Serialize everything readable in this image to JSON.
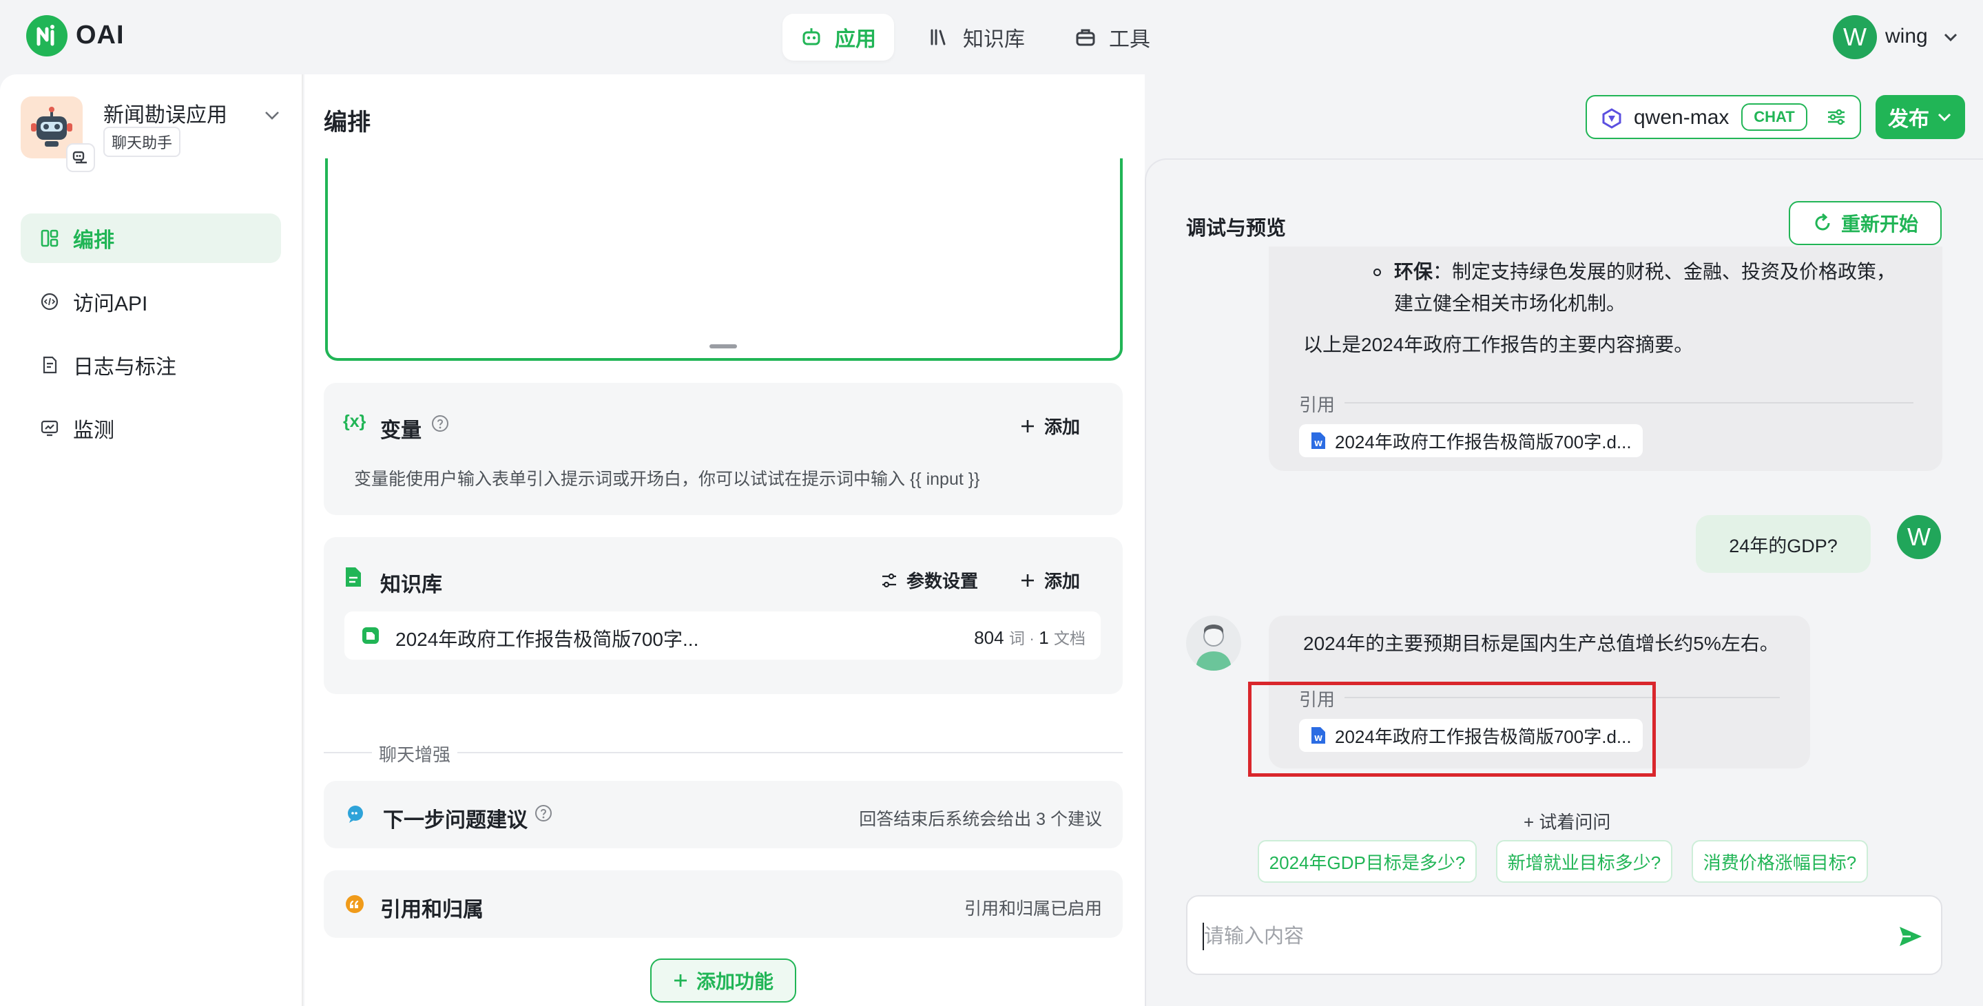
{
  "brand": {
    "name": "OAI"
  },
  "topnav": [
    {
      "label": "应用",
      "icon": "robot-icon",
      "active": true
    },
    {
      "label": "知识库",
      "icon": "books-icon",
      "active": false
    },
    {
      "label": "工具",
      "icon": "toolbox-icon",
      "active": false
    }
  ],
  "user": {
    "initial": "W",
    "name": "wing"
  },
  "app": {
    "name": "新闻勘误应用",
    "type": "聊天助手"
  },
  "sidebar": {
    "items": [
      {
        "label": "编排",
        "icon": "layout-icon",
        "active": true
      },
      {
        "label": "访问API",
        "icon": "api-icon",
        "active": false
      },
      {
        "label": "日志与标注",
        "icon": "log-icon",
        "active": false
      },
      {
        "label": "监测",
        "icon": "monitor-icon",
        "active": false
      }
    ]
  },
  "center": {
    "title": "编排",
    "variables": {
      "icon_text": "{x}",
      "title": "变量",
      "add_label": "添加",
      "desc": "变量能使用户输入表单引入提示词或开场白，你可以试试在提示词中输入 {{ input }}"
    },
    "knowledge": {
      "title": "知识库",
      "param_label": "参数设置",
      "add_label": "添加",
      "file_name": "2024年政府工作报告极简版700字...",
      "word_count": "804",
      "word_unit": "词 · ",
      "doc_count": "1",
      "doc_unit": "文档"
    },
    "section_label": "聊天增强",
    "next_question": {
      "title": "下一步问题建议",
      "desc": "回答结束后系统会给出 3 个建议"
    },
    "citation": {
      "title": "引用和归属",
      "desc": "引用和归属已启用"
    },
    "add_feature_label": "添加功能"
  },
  "model": {
    "name": "qwen-max",
    "tag": "CHAT"
  },
  "publish_label": "发布",
  "preview": {
    "title": "调试与预览",
    "restart_label": "重新开始",
    "msg1": {
      "bullet_bold": "环保",
      "bullet_rest": "：制定支持绿色发展的财税、金融、投资及价格政策，",
      "bullet_line2": "建立健全相关市场化机制。",
      "summary": "以上是2024年政府工作报告的主要内容摘要。",
      "cite_label": "引用",
      "cite_file": "2024年政府工作报告极简版700字.d..."
    },
    "user_msg": "24年的GDP?",
    "user_initial": "W",
    "msg2": {
      "text": "2024年的主要预期目标是国内生产总值增长约5%左右。",
      "cite_label": "引用",
      "cite_file": "2024年政府工作报告极简版700字.d..."
    },
    "try_ask": "+ 试着问问",
    "suggestions": [
      "2024年GDP目标是多少?",
      "新增就业目标多少?",
      "消费价格涨幅目标?"
    ],
    "input_placeholder": "请输入内容"
  },
  "colors": {
    "brand_green": "#21b556",
    "highlight_red": "#d9262c",
    "user_bubble": "#e3f2e7"
  }
}
